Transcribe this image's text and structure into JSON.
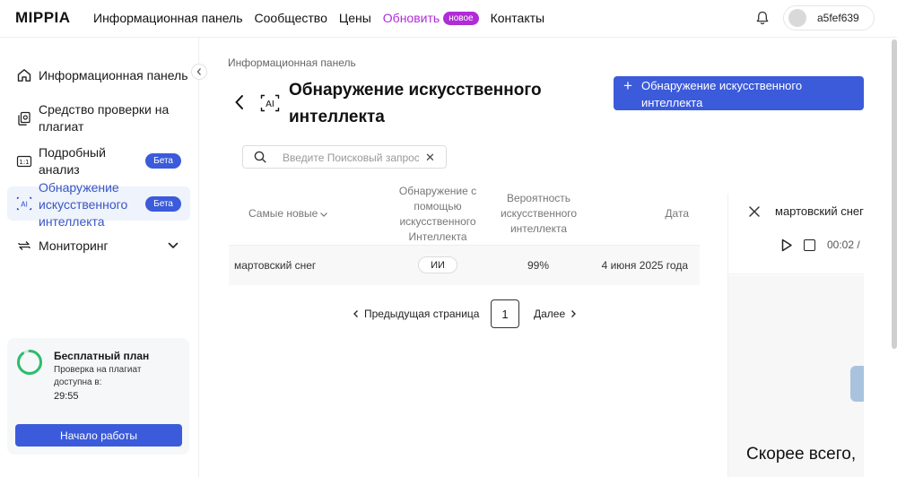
{
  "header": {
    "logo": "MIPPIA",
    "nav": [
      {
        "label": "Информационная панель"
      },
      {
        "label": "Сообщество"
      },
      {
        "label": "Цены"
      },
      {
        "label": "Обновить"
      },
      {
        "label": "Контакты"
      }
    ],
    "new_badge": "новое",
    "username": "a5fef639"
  },
  "sidebar": {
    "items": [
      {
        "label": "Информационная панель",
        "icon": "home-icon"
      },
      {
        "label": "Средство проверки на плагиат",
        "icon": "copy-check-icon"
      },
      {
        "label": "Подробный анализ",
        "icon": "one-to-one-icon",
        "badge": "Бета"
      },
      {
        "label": "Обнаружение искусственного интеллекта",
        "icon": "ai-icon",
        "badge": "Бета",
        "active": true
      },
      {
        "label": "Мониторинг",
        "icon": "arrows-cycle-icon",
        "expandable": true
      }
    ],
    "plan": {
      "title": "Бесплатный план",
      "text": "Проверка на плагиат доступна в:",
      "time": "29:55",
      "button": "Начало работы"
    }
  },
  "main": {
    "breadcrumb": "Информационная панель",
    "title": "Обнаружение искусственного интеллекта",
    "primary_button": "Обнаружение искусственного интеллекта",
    "search": {
      "placeholder": "Введите Поисковый запрос",
      "value": ""
    },
    "table": {
      "sort_label": "Самые новые",
      "columns": [
        "Обнаружение с помощью искусственного Интеллекта",
        "Вероятность искусственного интеллекта",
        "Дата"
      ],
      "rows": [
        {
          "name": "мартовский снег",
          "detection": "ИИ",
          "probability": "99%",
          "date": "4 июня 2025 года"
        }
      ]
    },
    "pagination": {
      "prev": "Предыдущая страница",
      "page": "1",
      "next": "Далее"
    }
  },
  "detail_panel": {
    "title": "мартовский снег",
    "time": "00:02 /",
    "verdict": "Скорее всего,"
  },
  "colors": {
    "accent": "#3b5bdb",
    "upgrade": "#b02cd6",
    "active_bg": "#eef3fc"
  }
}
